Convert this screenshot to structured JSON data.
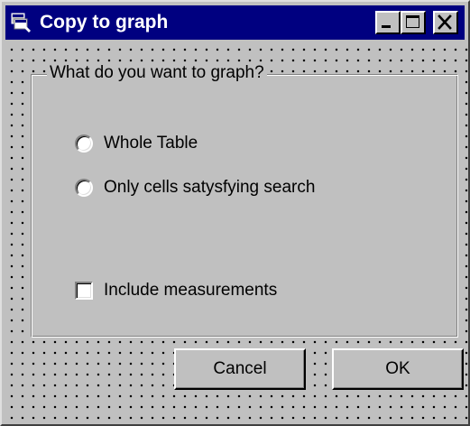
{
  "window": {
    "title": "Copy to graph",
    "controls": {
      "minimize_icon": "minimize-icon",
      "maximize_icon": "maximize-icon",
      "close_icon": "close-icon"
    },
    "title_bar_color": "#000080",
    "face_color": "#c0c0c0"
  },
  "group": {
    "legend": "What do you want to graph?",
    "options": [
      {
        "label": "Whole Table",
        "selected": false
      },
      {
        "label": "Only cells satysfying search",
        "selected": false
      }
    ],
    "checkbox": {
      "label": "Include measurements",
      "checked": false
    }
  },
  "buttons": {
    "cancel_label": "Cancel",
    "ok_label": "OK"
  }
}
